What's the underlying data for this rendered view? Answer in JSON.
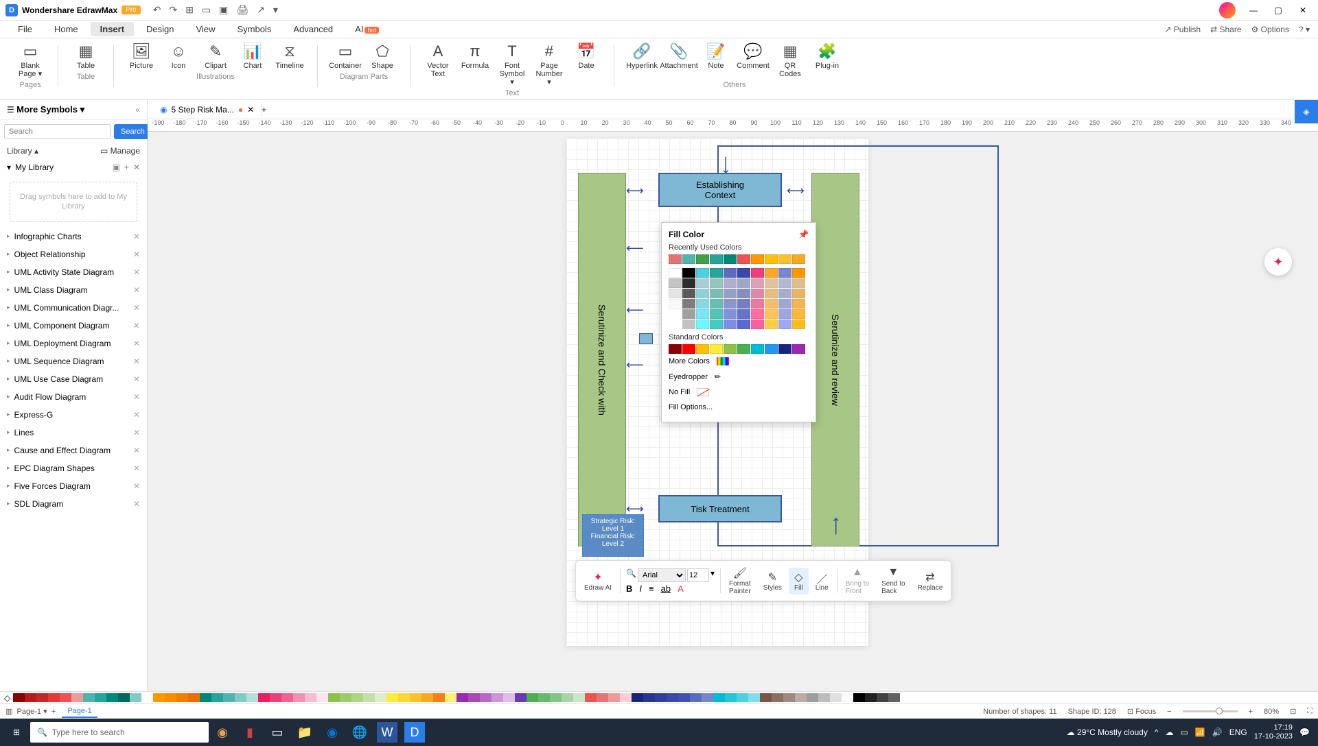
{
  "app": {
    "title": "Wondershare EdrawMax",
    "badge": "Pro"
  },
  "menubar": {
    "items": [
      "File",
      "Home",
      "Insert",
      "Design",
      "View",
      "Symbols",
      "Advanced",
      "AI"
    ],
    "active": "Insert",
    "right": {
      "publish": "Publish",
      "share": "Share",
      "options": "Options"
    }
  },
  "ribbon": {
    "groups": [
      {
        "label": "Pages",
        "items": [
          {
            "icon": "▭",
            "label": "Blank\nPage ▾"
          }
        ]
      },
      {
        "label": "Table",
        "items": [
          {
            "icon": "▦",
            "label": "Table"
          }
        ]
      },
      {
        "label": "Illustrations",
        "items": [
          {
            "icon": "🖼",
            "label": "Picture"
          },
          {
            "icon": "☺",
            "label": "Icon"
          },
          {
            "icon": "✎",
            "label": "Clipart"
          },
          {
            "icon": "📊",
            "label": "Chart"
          },
          {
            "icon": "⧖",
            "label": "Timeline"
          }
        ]
      },
      {
        "label": "Diagram Parts",
        "items": [
          {
            "icon": "▭",
            "label": "Container"
          },
          {
            "icon": "⬠",
            "label": "Shape"
          }
        ]
      },
      {
        "label": "Text",
        "items": [
          {
            "icon": "A",
            "label": "Vector\nText"
          },
          {
            "icon": "π",
            "label": "Formula"
          },
          {
            "icon": "T",
            "label": "Font\nSymbol ▾"
          },
          {
            "icon": "#",
            "label": "Page\nNumber ▾"
          },
          {
            "icon": "📅",
            "label": "Date"
          }
        ]
      },
      {
        "label": "Others",
        "items": [
          {
            "icon": "🔗",
            "label": "Hyperlink"
          },
          {
            "icon": "📎",
            "label": "Attachment"
          },
          {
            "icon": "📝",
            "label": "Note"
          },
          {
            "icon": "💬",
            "label": "Comment"
          },
          {
            "icon": "▦",
            "label": "QR\nCodes"
          },
          {
            "icon": "🧩",
            "label": "Plug-in"
          }
        ]
      }
    ]
  },
  "sidebar": {
    "title": "More Symbols ▾",
    "search_placeholder": "Search",
    "search_btn": "Search",
    "library": "Library ▴",
    "manage": "▭ Manage",
    "mylib": "My Library",
    "dropzone": "Drag symbols\nhere to add to\nMy Library",
    "items": [
      "Infographic Charts",
      "Object Relationship",
      "UML Activity State Diagram",
      "UML Class Diagram",
      "UML Communication Diagr...",
      "UML Component Diagram",
      "UML Deployment Diagram",
      "UML Sequence Diagram",
      "UML Use Case Diagram",
      "Audit Flow Diagram",
      "Express-G",
      "Lines",
      "Cause and Effect Diagram",
      "EPC Diagram Shapes",
      "Five Forces Diagram",
      "SDL Diagram"
    ]
  },
  "tab": {
    "name": "5 Step Risk Ma..."
  },
  "ruler_ticks": [
    "-190",
    "-180",
    "-170",
    "-160",
    "-150",
    "-140",
    "-130",
    "-120",
    "-110",
    "-100",
    "-90",
    "-80",
    "-70",
    "-60",
    "-50",
    "-40",
    "-30",
    "-20",
    "-10",
    "0",
    "10",
    "20",
    "30",
    "40",
    "50",
    "60",
    "70",
    "80",
    "90",
    "100",
    "110",
    "120",
    "130",
    "140",
    "150",
    "160",
    "170",
    "180",
    "190",
    "200",
    "210",
    "220",
    "230",
    "240",
    "250",
    "260",
    "270",
    "280",
    "290",
    "300",
    "310",
    "320",
    "330",
    "340"
  ],
  "diagram": {
    "box1": "Establishing\nContext",
    "left_bar": "Serutinize and Check with",
    "right_bar": "Serutinize and review",
    "box2": "Tisk Treatment",
    "selected": "Strategic Risk:\nLevel 1\nFinancial Risk:\nLevel 2"
  },
  "fillpopup": {
    "title": "Fill Color",
    "recent": "Recently Used Colors",
    "standard": "Standard Colors",
    "more": "More Colors",
    "eyedropper": "Eyedropper",
    "nofill": "No Fill",
    "options": "Fill Options...",
    "recent_colors": [
      "#e57373",
      "#4db6ac",
      "#43a047",
      "#26a69a",
      "#00897b",
      "#ef5350",
      "#ff9800",
      "#ffc107",
      "#fbc02d",
      "#f9a825"
    ],
    "theme_colors": [
      "#ffffff",
      "#000000",
      "#4dd0e1",
      "#26a69a",
      "#5c6bc0",
      "#3949ab",
      "#ec407a",
      "#ffa726",
      "#7986cb",
      "#ff9800"
    ],
    "std_colors": [
      "#8b0000",
      "#ff0000",
      "#ffc107",
      "#ffeb3b",
      "#8bc34a",
      "#4caf50",
      "#00bcd4",
      "#2196f3",
      "#1a237e",
      "#9c27b0"
    ]
  },
  "float_toolbar": {
    "ai": "Edraw AI",
    "font": "Arial",
    "size": "12",
    "format_painter": "Format\nPainter",
    "styles": "Styles",
    "fill": "Fill",
    "line": "Line",
    "bring": "Bring to\nFront",
    "send": "Send to\nBack",
    "replace": "Replace"
  },
  "statusbar": {
    "page": "Page-1",
    "shapes": "Number of shapes: 11",
    "shapeid": "Shape ID: 128",
    "focus": "Focus",
    "zoom": "80%"
  },
  "palette": [
    "#8b0000",
    "#b71c1c",
    "#c62828",
    "#e53935",
    "#ef5350",
    "#ef9a9a",
    "#4db6ac",
    "#26a69a",
    "#00897b",
    "#00695c",
    "#80cbc4",
    "#ffffff",
    "#ff9800",
    "#fb8c00",
    "#f57c00",
    "#ef6c00",
    "#00897b",
    "#26a69a",
    "#4db6ac",
    "#80cbc4",
    "#b2dfdb",
    "#e91e63",
    "#ec407a",
    "#f06292",
    "#f48fb1",
    "#f8bbd0",
    "#fce4ec",
    "#8bc34a",
    "#9ccc65",
    "#aed581",
    "#c5e1a5",
    "#dcedc8",
    "#ffeb3b",
    "#fdd835",
    "#fbc02d",
    "#f9a825",
    "#f57f17",
    "#fff176",
    "#9c27b0",
    "#ab47bc",
    "#ba68c8",
    "#ce93d8",
    "#e1bee7",
    "#673ab7",
    "#4caf50",
    "#66bb6a",
    "#81c784",
    "#a5d6a7",
    "#c8e6c9",
    "#ef5350",
    "#e57373",
    "#ef9a9a",
    "#ffcdd2",
    "#1a237e",
    "#283593",
    "#303f9f",
    "#3949ab",
    "#3f51b5",
    "#5c6bc0",
    "#7986cb",
    "#00bcd4",
    "#26c6da",
    "#4dd0e1",
    "#80deea",
    "#795548",
    "#8d6e63",
    "#a1887f",
    "#bcaaa4",
    "#9e9e9e",
    "#bdbdbd",
    "#e0e0e0",
    "#fafafa",
    "#000000",
    "#212121",
    "#424242",
    "#616161"
  ],
  "taskbar": {
    "search": "Type here to search",
    "weather": "29°C  Mostly cloudy",
    "lang": "ENG",
    "time": "17:19",
    "date": "17-10-2023"
  }
}
